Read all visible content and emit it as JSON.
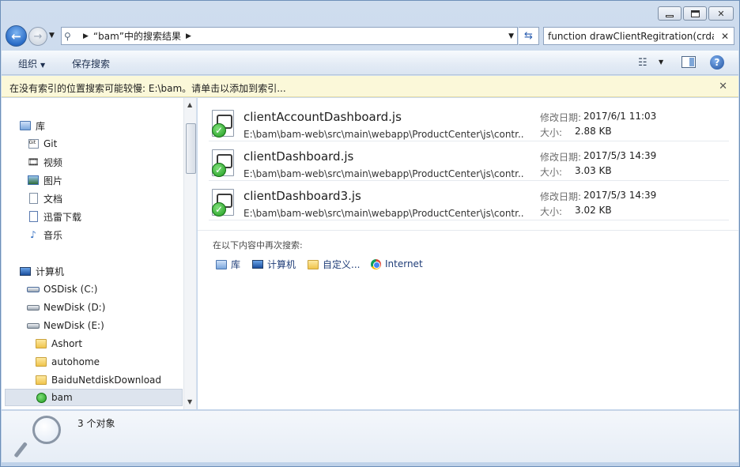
{
  "window": {
    "address": {
      "crumb": "“bam”中的搜索结果"
    },
    "search_query": "function drawClientRegitration(crdat"
  },
  "command_bar": {
    "organize": "组织",
    "save_search": "保存搜索"
  },
  "info_bar": {
    "text": "在没有索引的位置搜索可能较慢: E:\\bam。请单击以添加到索引..."
  },
  "nav": {
    "library": "库",
    "libraries": [
      "Git",
      "视频",
      "图片",
      "文档",
      "迅雷下载",
      "音乐"
    ],
    "computer": "计算机",
    "drives": [
      "OSDisk (C:)",
      "NewDisk (D:)",
      "NewDisk (E:)"
    ],
    "folders": [
      "Ashort",
      "autohome",
      "BaiduNetdiskDownload",
      "bam"
    ]
  },
  "results": [
    {
      "name": "clientAccountDashboard.js",
      "path": "E:\\bam\\bam-web\\src\\main\\webapp\\ProductCenter\\js\\contr...",
      "modified_label": "修改日期:",
      "modified": "2017/6/1 11:03",
      "size_label": "大小:",
      "size": "2.88 KB"
    },
    {
      "name": "clientDashboard.js",
      "path": "E:\\bam\\bam-web\\src\\main\\webapp\\ProductCenter\\js\\contr...",
      "modified_label": "修改日期:",
      "modified": "2017/5/3 14:39",
      "size_label": "大小:",
      "size": "3.03 KB"
    },
    {
      "name": "clientDashboard3.js",
      "path": "E:\\bam\\bam-web\\src\\main\\webapp\\ProductCenter\\js\\contr...",
      "modified_label": "修改日期:",
      "modified": "2017/5/3 14:39",
      "size_label": "大小:",
      "size": "3.02 KB"
    }
  ],
  "search_again": {
    "title": "在以下内容中再次搜索:",
    "items": [
      "库",
      "计算机",
      "自定义...",
      "Internet"
    ]
  },
  "details": {
    "count": "3 个对象"
  }
}
